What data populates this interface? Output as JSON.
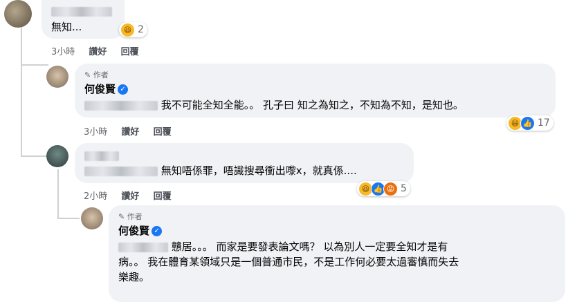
{
  "comments": [
    {
      "text": "無知...",
      "reaction_count": "2",
      "time": "3小時",
      "like_label": "讚好",
      "reply_label": "回覆"
    },
    {
      "author_badge": "作者",
      "name": "何俊賢",
      "text": "我不可能全知全能。。 孔子曰 知之為知之，不知為不知，是知也。",
      "reaction_count": "17",
      "time": "3小時",
      "like_label": "讚好",
      "reply_label": "回覆"
    },
    {
      "text": "無知唔係罪，唔識搜尋衝出嚟x，就真係....",
      "reaction_count": "5",
      "time": "2小時",
      "like_label": "讚好",
      "reply_label": "回覆"
    },
    {
      "author_badge": "作者",
      "name": "何俊賢",
      "text_line1": "戇居。。。 而家是要發表論文嗎？ 以為別人一定要全知才是有",
      "text_line2": "病。。 我在體育某領域只是一個普通市民，不是工作何必要太過審慎而失去",
      "text_line3": "樂趣。"
    }
  ],
  "icons": {
    "author_badge": "pencil-icon",
    "verified": "verified-badge-icon",
    "reactions": [
      "haha-reaction",
      "like-reaction",
      "angry-reaction"
    ]
  },
  "colors": {
    "bubble": "#f0f2f5",
    "like_blue": "#1877f2",
    "haha_yellow": "#f7b928",
    "angry_orange": "#e9710f",
    "meta_gray": "#65676b"
  }
}
